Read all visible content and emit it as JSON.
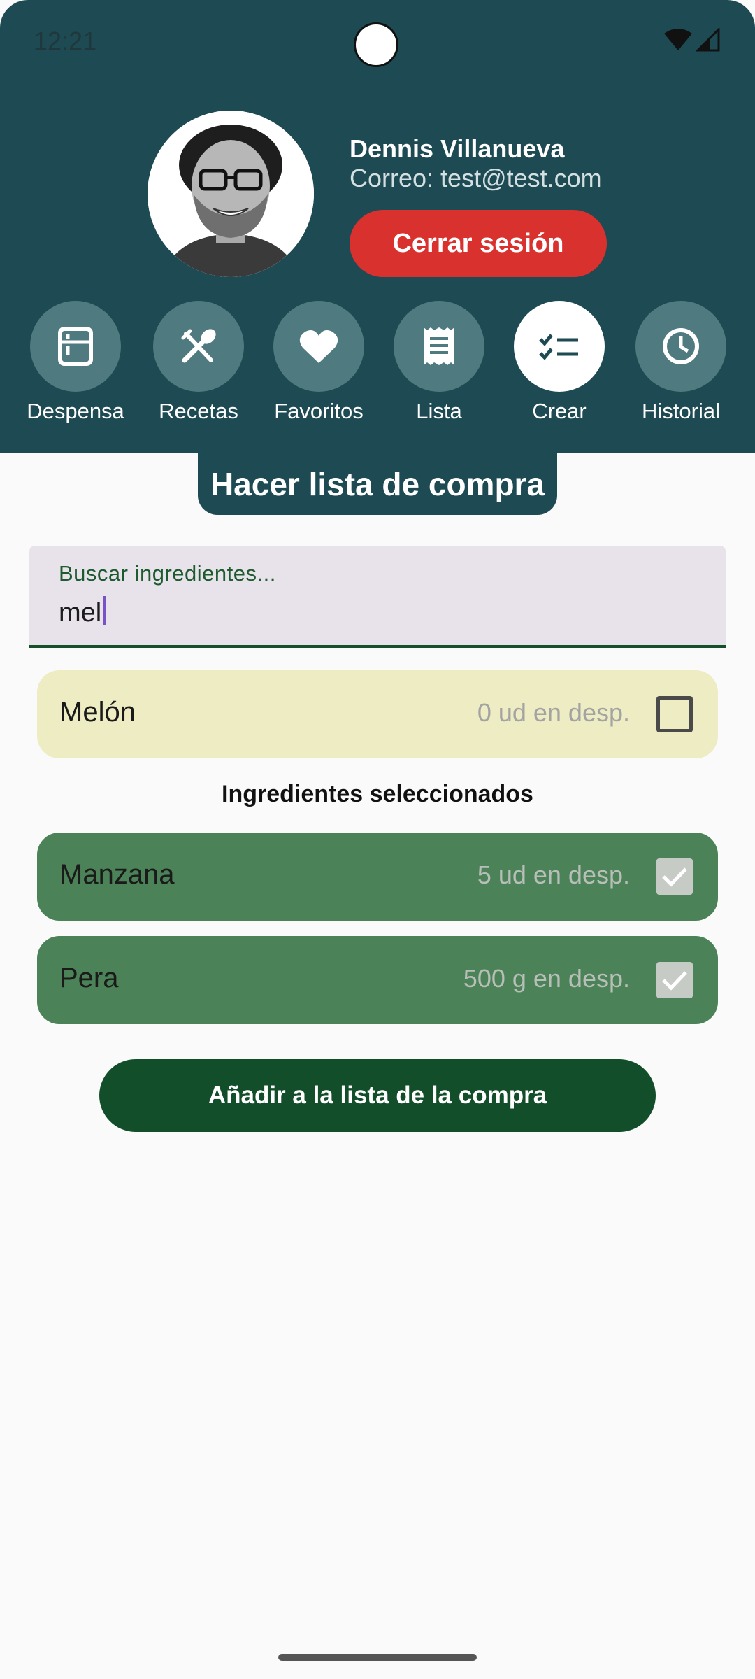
{
  "status_bar": {
    "time": "12:21"
  },
  "profile": {
    "name": "Dennis Villanueva",
    "email": "Correo: test@test.com",
    "logout_label": "Cerrar sesión"
  },
  "nav": {
    "items": [
      {
        "label": "Despensa",
        "icon": "fridge-icon"
      },
      {
        "label": "Recetas",
        "icon": "utensils-icon"
      },
      {
        "label": "Favoritos",
        "icon": "heart-icon"
      },
      {
        "label": "Lista",
        "icon": "receipt-icon"
      },
      {
        "label": "Crear",
        "icon": "checklist-icon",
        "active": true
      },
      {
        "label": "Historial",
        "icon": "clock-icon"
      }
    ]
  },
  "page_title": "Hacer lista de compra",
  "search": {
    "label": "Buscar ingredientes...",
    "value": "mel"
  },
  "results": [
    {
      "name": "Melón",
      "quantity": "0 ud en desp.",
      "checked": false
    }
  ],
  "selected_heading": "Ingredientes seleccionados",
  "selected": [
    {
      "name": "Manzana",
      "quantity": "5 ud en desp.",
      "checked": true
    },
    {
      "name": "Pera",
      "quantity": "500 g en desp.",
      "checked": true
    }
  ],
  "add_button_label": "Añadir a la lista de la compra",
  "colors": {
    "header": "#1d4a53",
    "logout": "#d9312e",
    "result_card": "#eeecc2",
    "selected_card": "#4c8257",
    "primary_button": "#124e2a"
  }
}
